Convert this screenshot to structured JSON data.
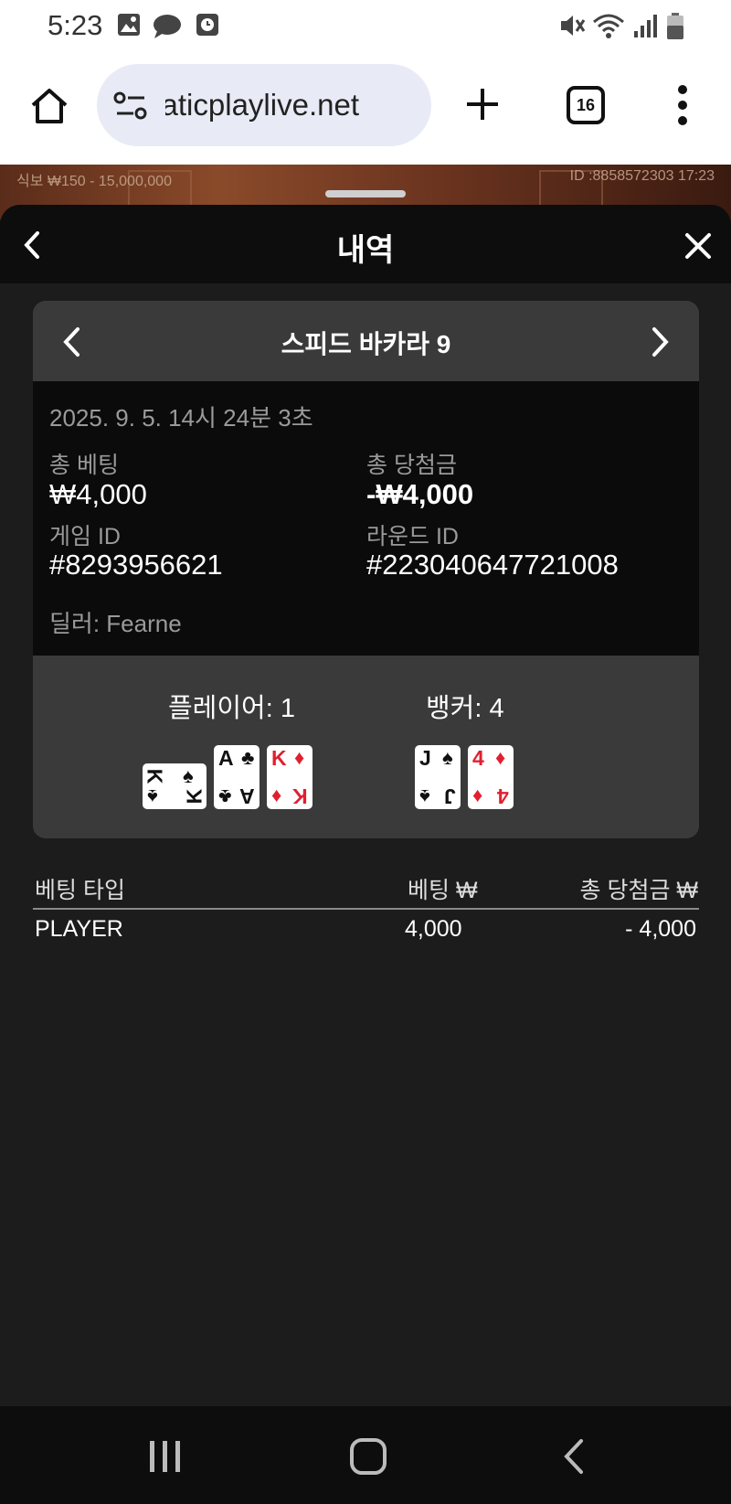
{
  "status_bar": {
    "time": "5:23"
  },
  "browser": {
    "url": "pragmaticplaylive.net",
    "tab_count": "16"
  },
  "game_strip": {
    "limits": "식보 ₩150 - 15,000,000",
    "id_time": "ID :8858572303 17:23"
  },
  "history": {
    "title": "내역",
    "game_title": "스피드 바카라 9",
    "datetime": "2025. 9. 5. 14시 24분 3초",
    "total_bet_label": "총 베팅",
    "total_bet": "₩4,000",
    "total_win_label": "총 당첨금",
    "total_win": "-₩4,000",
    "game_id_label": "게임 ID",
    "game_id": "#8293956621",
    "round_id_label": "라운드 ID",
    "round_id": "#223040647721008",
    "dealer": "딜러: Fearne",
    "player_label": "플레이어: 1",
    "banker_label": "뱅커: 4",
    "player_cards": [
      {
        "rank": "K",
        "suit": "♠",
        "color": "#111111",
        "sideways": true
      },
      {
        "rank": "A",
        "suit": "♣",
        "color": "#111111",
        "sideways": false
      },
      {
        "rank": "K",
        "suit": "♦",
        "color": "#e02030",
        "sideways": false
      }
    ],
    "banker_cards": [
      {
        "rank": "J",
        "suit": "♠",
        "color": "#111111",
        "sideways": false
      },
      {
        "rank": "4",
        "suit": "♦",
        "color": "#e02030",
        "sideways": false
      }
    ],
    "table": {
      "headers": [
        "베팅 타입",
        "베팅 ₩",
        "총 당첨금 ₩"
      ],
      "rows": [
        [
          "PLAYER",
          "4,000",
          "- 4,000"
        ]
      ]
    }
  }
}
